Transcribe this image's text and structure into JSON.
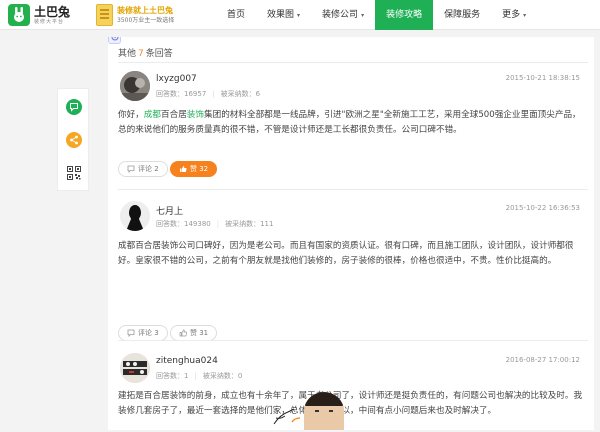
{
  "header": {
    "logo": {
      "name": "土巴兔",
      "slogan": "装修大平台"
    },
    "promo": {
      "title": "装修就上土巴兔",
      "subtitle": "3500万业主一致选择"
    },
    "nav": [
      {
        "label": "首页",
        "dropdown": false,
        "active": false
      },
      {
        "label": "效果图",
        "dropdown": true,
        "active": false
      },
      {
        "label": "装修公司",
        "dropdown": true,
        "active": false
      },
      {
        "label": "装修攻略",
        "dropdown": false,
        "active": true
      },
      {
        "label": "保障服务",
        "dropdown": false,
        "active": false
      },
      {
        "label": "更多",
        "dropdown": true,
        "active": false
      }
    ]
  },
  "sidebar": {
    "icons": [
      "question-icon",
      "share-icon",
      "qr-code-icon"
    ],
    "colors": {
      "question": "#1fb056",
      "share": "#f5a623"
    }
  },
  "answers_header": {
    "prefix": "其他",
    "count": "7",
    "suffix": "条回答"
  },
  "answers": [
    {
      "user": "lxyzg007",
      "answer_count_label": "回答数：16957",
      "accepted_label": "被采纳数：6",
      "date": "2015-10-21 18:38:15",
      "body_parts": [
        {
          "text": "你好，",
          "hl": false
        },
        {
          "text": "成都",
          "hl": true
        },
        {
          "text": "百合居",
          "hl": false
        },
        {
          "text": "装饰",
          "hl": true
        },
        {
          "text": "集团的材料全部都是一线品牌，引进\"欧洲之星\"全新施工工艺，采用全球500强企业里面顶尖产品，总的来说他们的服务质量真的很不错，不管是设计师还是工长都很负责任。公司口碑不错。",
          "hl": false
        }
      ],
      "comment_label": "评论 2",
      "like_label": "赞 32",
      "like_active": true
    },
    {
      "user": "七月上",
      "answer_count_label": "回答数：149380",
      "accepted_label": "被采纳数：111",
      "date": "2015-10-22 16:36:53",
      "body_parts": [
        {
          "text": "成都百合居装饰公司口碑好，因为是老公司。而且有国家的资质认证。很有口碑，而且施工团队，设计团队，设计师都很好。皇家很不错的公司，之前有个朋友就是找他们装修的，房子装修的很棒，价格也很适中，不贵。性价比挺高的。",
          "hl": false
        }
      ],
      "comment_label": "评论 3",
      "like_label": "赞 31",
      "like_active": false
    },
    {
      "user": "zitenghua024",
      "answer_count_label": "回答数：1",
      "accepted_label": "被采纳数：0",
      "date": "2016-08-27 17:00:12",
      "body_parts": [
        {
          "text": "建拓是百合居装饰的前身，成立也有十余年了，属于老公司了，设计师还是挺负责任的，有问题公司也解决的比较及时。我装修几套房子了，最近一套选择的是他们家，总体来说还可以，中间有点小问题后来也及时解决了。",
          "hl": false
        }
      ]
    }
  ]
}
